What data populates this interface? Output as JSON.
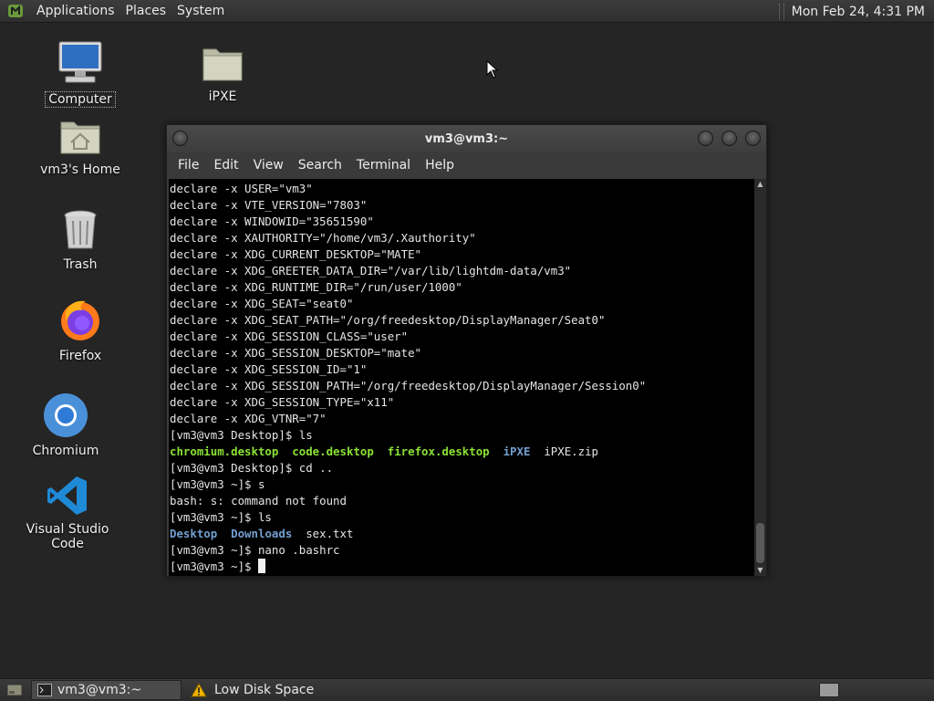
{
  "top_panel": {
    "menus": [
      "Applications",
      "Places",
      "System"
    ],
    "clock": "Mon Feb 24,  4:31 PM"
  },
  "desktop_icons": {
    "computer": "Computer",
    "home": "vm3's Home",
    "trash": "Trash",
    "firefox": "Firefox",
    "chromium": "Chromium",
    "vscode": "Visual Studio Code",
    "ipxe": "iPXE"
  },
  "terminal": {
    "title": "vm3@vm3:~",
    "menu": [
      "File",
      "Edit",
      "View",
      "Search",
      "Terminal",
      "Help"
    ],
    "lines": [
      "declare -x USER=\"vm3\"",
      "declare -x VTE_VERSION=\"7803\"",
      "declare -x WINDOWID=\"35651590\"",
      "declare -x XAUTHORITY=\"/home/vm3/.Xauthority\"",
      "declare -x XDG_CURRENT_DESKTOP=\"MATE\"",
      "declare -x XDG_GREETER_DATA_DIR=\"/var/lib/lightdm-data/vm3\"",
      "declare -x XDG_RUNTIME_DIR=\"/run/user/1000\"",
      "declare -x XDG_SEAT=\"seat0\"",
      "declare -x XDG_SEAT_PATH=\"/org/freedesktop/DisplayManager/Seat0\"",
      "declare -x XDG_SESSION_CLASS=\"user\"",
      "declare -x XDG_SESSION_DESKTOP=\"mate\"",
      "declare -x XDG_SESSION_ID=\"1\"",
      "declare -x XDG_SESSION_PATH=\"/org/freedesktop/DisplayManager/Session0\"",
      "declare -x XDG_SESSION_TYPE=\"x11\"",
      "declare -x XDG_VTNR=\"7\"",
      "[vm3@vm3 Desktop]$ ls"
    ],
    "ls_desktop": {
      "green": [
        "chromium.desktop",
        "code.desktop",
        "firefox.desktop"
      ],
      "blue": "iPXE",
      "plain": "iPXE.zip"
    },
    "lines_mid": [
      "[vm3@vm3 Desktop]$ cd ..",
      "[vm3@vm3 ~]$ s",
      "bash: s: command not found",
      "[vm3@vm3 ~]$ ls"
    ],
    "ls_home": {
      "blue": [
        "Desktop",
        "Downloads"
      ],
      "plain": "sex.txt"
    },
    "lines_end": [
      "[vm3@vm3 ~]$ nano .bashrc"
    ],
    "prompt": "[vm3@vm3 ~]$ "
  },
  "taskbar": {
    "terminal_task": "vm3@vm3:~",
    "warning_task": "Low Disk Space"
  },
  "colors": {
    "green_text": "#8ae234",
    "blue_text": "#729fcf",
    "warning": "#f0b400"
  }
}
